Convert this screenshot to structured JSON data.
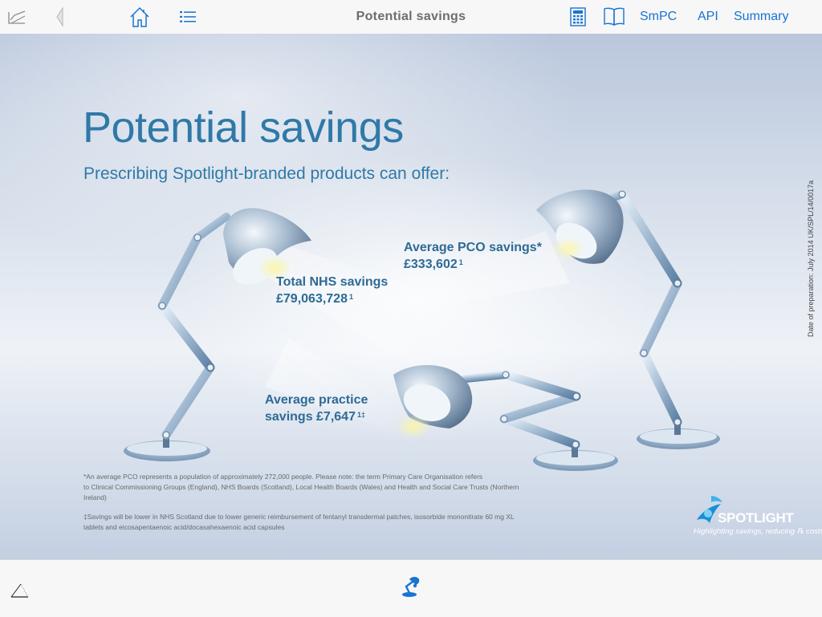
{
  "toolbar": {
    "title": "Potential savings",
    "links": {
      "smpc": "SmPC",
      "api": "API",
      "summary": "Summary"
    },
    "icons": [
      "edit-icon",
      "back-icon",
      "home-icon",
      "list-icon",
      "calculator-icon",
      "book-icon"
    ],
    "accent_color": "#1a73d1"
  },
  "slide": {
    "title": "Potential savings",
    "subtitle": "Prescribing Spotlight-branded products can offer:",
    "stats": {
      "nhs": {
        "label": "Total NHS savings",
        "value": "£79,063,728",
        "ref": "1"
      },
      "pco": {
        "label": "Average PCO savings*",
        "value": "£333,602",
        "ref": "1"
      },
      "practice": {
        "line1": "Average practice",
        "line2": "savings £7,647",
        "ref": "1‡"
      }
    },
    "date_prep": "Date of preparation: July 2014 UK/SPL/14/0017a",
    "footnotes": {
      "pco_1": "*An average PCO represents a population of approximately 272,000 people. Please note: the term Primary Care Organisation refers",
      "pco_2": "to Clinical Commissioning Groups (England), NHS Boards (Scotland), Local Health Boards (Wales) and Health and Social Care Trusts (Northern",
      "pco_3": "Ireland)",
      "scot_1": "‡Savings will be lower in NHS Scotland due to lower generic reimbursement of fentanyl transdermal patches, isosorbide mononitrate 60 mg XL",
      "scot_2": "tablets and eicosapentaenoic acid/docasahexaenoic acid capsules"
    },
    "logo": {
      "name": "SPOTLIGHT",
      "tagline": "Highlighting savings, reducing ℞ costs",
      "color": "#1a8fd6"
    },
    "title_color": "#2f79a7"
  },
  "bottombar": {
    "icons": [
      "collapse-corner-icon",
      "spotlight-lamp-icon"
    ]
  }
}
